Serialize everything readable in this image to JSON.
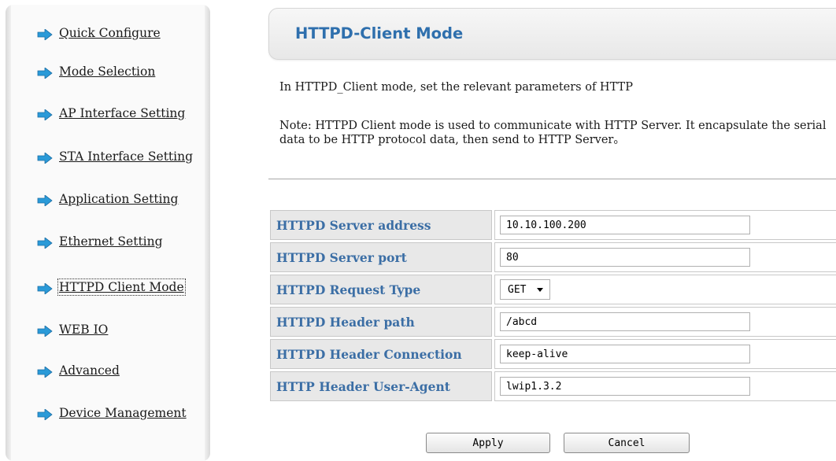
{
  "sidebar": {
    "items": [
      {
        "label": "Quick Configure",
        "icon": "arrow-right-icon"
      },
      {
        "label": "Mode Selection",
        "icon": "arrow-right-icon"
      },
      {
        "label": "AP Interface Setting",
        "icon": "arrow-right-icon"
      },
      {
        "label": "STA Interface Setting",
        "icon": "arrow-right-icon"
      },
      {
        "label": "Application Setting",
        "icon": "arrow-right-icon"
      },
      {
        "label": "Ethernet Setting",
        "icon": "arrow-right-icon"
      },
      {
        "label": "HTTPD Client Mode",
        "icon": "arrow-right-icon",
        "active": true
      },
      {
        "label": "WEB IO",
        "icon": "arrow-right-icon"
      },
      {
        "label": "Advanced",
        "icon": "arrow-right-icon"
      },
      {
        "label": "Device Management",
        "icon": "arrow-right-icon"
      }
    ]
  },
  "main": {
    "title": "HTTPD-Client Mode",
    "intro": "In HTTPD_Client mode, set the relevant parameters of HTTP",
    "note": "Note: HTTPD Client mode is used to communicate with HTTP Server. It encapsulate the serial data to be HTTP protocol data, then send to HTTP Server。"
  },
  "form": {
    "rows": [
      {
        "label": "HTTPD Server address",
        "type": "text",
        "value": "10.10.100.200"
      },
      {
        "label": "HTTPD Server port",
        "type": "text",
        "value": "80"
      },
      {
        "label": "HTTPD Request Type",
        "type": "select",
        "value": "GET"
      },
      {
        "label": "HTTPD Header path",
        "type": "text",
        "value": "/abcd"
      },
      {
        "label": "HTTPD Header Connection",
        "type": "text",
        "value": "keep-alive"
      },
      {
        "label": "HTTP Header User-Agent",
        "type": "text",
        "value": "lwip1.3.2"
      }
    ]
  },
  "buttons": {
    "apply": "Apply",
    "cancel": "Cancel"
  },
  "colors": {
    "title": "#2e6fad",
    "label_text": "#3b6ea5",
    "label_bg": "#e8e8e8",
    "arrow_icon": "#2a9ad8"
  }
}
